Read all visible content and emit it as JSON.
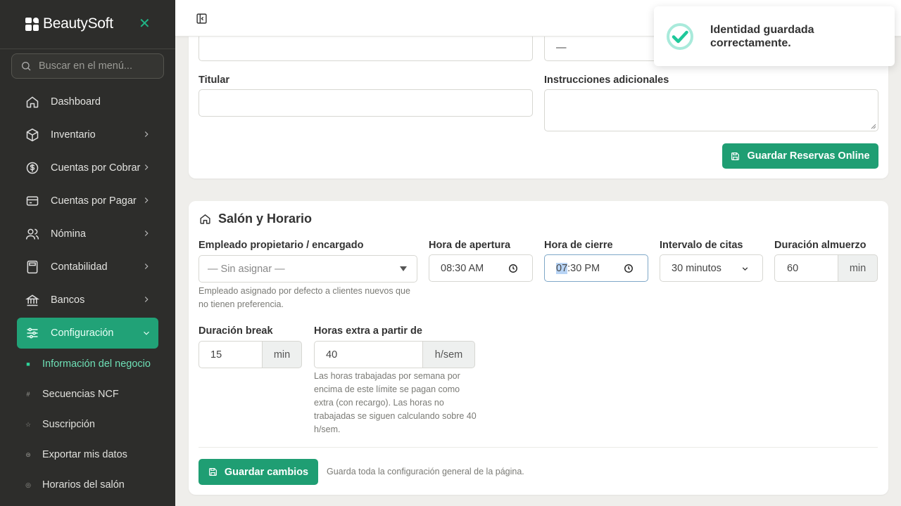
{
  "brand": {
    "name": "BeautySoft"
  },
  "sidebar": {
    "search_placeholder": "Buscar en el menú...",
    "items": [
      {
        "label": "Dashboard",
        "icon": "home-icon"
      },
      {
        "label": "Inventario",
        "icon": "box-icon"
      },
      {
        "label": "Cuentas por Cobrar",
        "icon": "dollar-icon"
      },
      {
        "label": "Cuentas por Pagar",
        "icon": "credit-card-icon"
      },
      {
        "label": "Nómina",
        "icon": "users-icon"
      },
      {
        "label": "Contabilidad",
        "icon": "calculator-icon"
      },
      {
        "label": "Bancos",
        "icon": "bank-icon"
      },
      {
        "label": "Configuración",
        "icon": "sliders-icon"
      }
    ],
    "sub_items": [
      {
        "label": "Información del negocio",
        "bullet": "■"
      },
      {
        "label": "Secuencias NCF",
        "bullet": "#"
      },
      {
        "label": "Suscripción",
        "bullet": "☆"
      },
      {
        "label": "Exportar mis datos",
        "bullet": "⊜"
      },
      {
        "label": "Horarios del salón",
        "bullet": "◎"
      }
    ]
  },
  "reservas": {
    "partial_value": "—",
    "titular_label": "Titular",
    "titular_value": "",
    "instructions_label": "Instrucciones adicionales",
    "instructions_value": "",
    "save_label": "Guardar Reservas Online"
  },
  "salon": {
    "title": "Salón y Horario",
    "owner_label": "Empleado propietario / encargado",
    "owner_value": "— Sin asignar —",
    "owner_help": "Empleado asignado por defecto a clientes nuevos que no tienen preferencia.",
    "open_label": "Hora de apertura",
    "open_value": "08:30  AM",
    "close_label": "Hora de cierre",
    "close_hour": "07",
    "close_rest": ":30  PM",
    "interval_label": "Intervalo de citas",
    "interval_value": "30 minutos",
    "lunch_label": "Duración almuerzo",
    "lunch_value": "60",
    "lunch_unit": "min",
    "break_label": "Duración break",
    "break_value": "15",
    "break_unit": "min",
    "overtime_label": "Horas extra a partir de",
    "overtime_value": "40",
    "overtime_unit": "h/sem",
    "overtime_help": "Las horas trabajadas por semana por encima de este límite se pagan como extra (con recargo). Las horas no trabajadas se siguen calculando sobre 40 h/sem.",
    "save_label": "Guardar cambios",
    "save_help": "Guarda toda la configuración general de la página."
  },
  "toast": {
    "message": "Identidad guardada correctamente."
  },
  "colors": {
    "sidebar_bg": "#2d2d2b",
    "accent": "#1f9e73",
    "active_nav": "#21a277",
    "page_bg": "#efeeeb"
  }
}
